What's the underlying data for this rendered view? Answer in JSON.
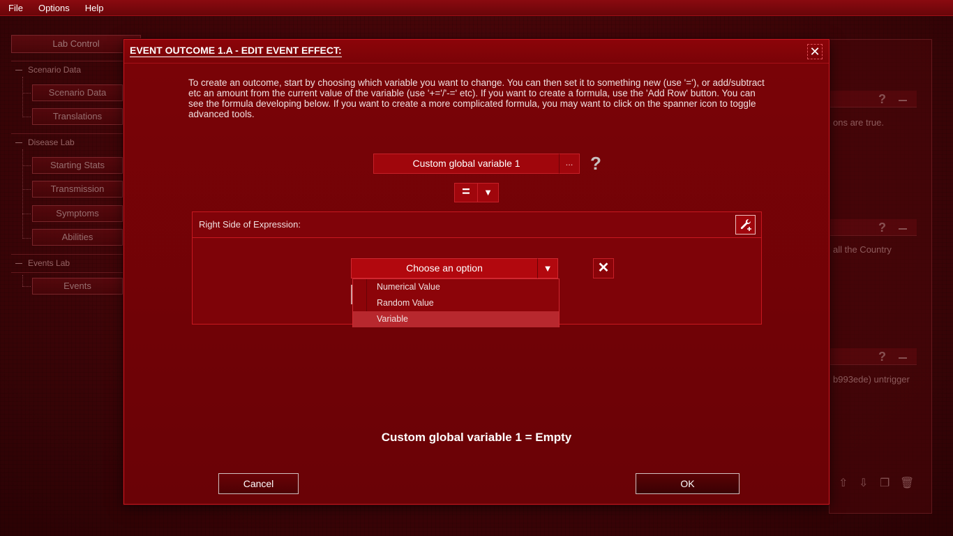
{
  "menu": {
    "items": [
      "File",
      "Options",
      "Help"
    ]
  },
  "left_panel": {
    "lab_control": "Lab Control",
    "sections": [
      {
        "label": "Scenario Data",
        "items": [
          "Scenario Data",
          "Translations"
        ]
      },
      {
        "label": "Disease Lab",
        "items": [
          "Starting Stats",
          "Transmission",
          "Symptoms",
          "Abilities"
        ]
      },
      {
        "label": "Events Lab",
        "items": [
          "Events"
        ]
      }
    ]
  },
  "right_panel": {
    "text_1": "ons are true.",
    "text_2": "all the Country",
    "text_3": "b993ede) untrigger",
    "help_mark": "?"
  },
  "dialog": {
    "title": "EVENT OUTCOME 1.A - EDIT EVENT EFFECT:",
    "instructions": "To create an outcome, start by choosing which variable you want to change. You can then set it to something new (use '='), or add/subtract etc an amount from the current value of the variable (use '+='/'-=' etc). If you want to create a formula, use the 'Add Row' button. You can see the formula developing below. If you want to create a more complicated formula, you may want to click on the spanner icon to toggle advanced tools.",
    "variable": "Custom global variable 1",
    "variable_more": "...",
    "help_mark": "?",
    "operator": "=",
    "rhs_label": "Right Side of Expression:",
    "choose_placeholder": "Choose an option",
    "dropdown_options": [
      "Numerical Value",
      "Random Value",
      "Variable"
    ],
    "dropdown_selected": "Variable",
    "expression_preview": "Custom global variable 1 = Empty",
    "cancel_label": "Cancel",
    "ok_label": "OK"
  },
  "colors": {
    "accent": "#c81820",
    "dialog_bg": "#7a0307",
    "selected_option": "#b8282e"
  }
}
